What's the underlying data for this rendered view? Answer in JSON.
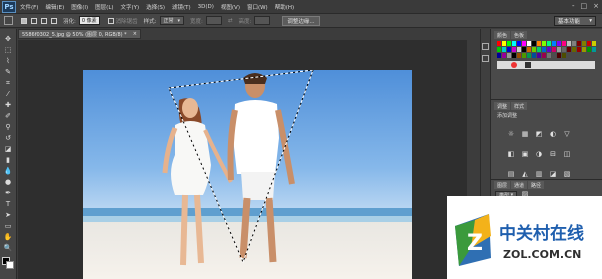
{
  "app": {
    "logo_text": "Ps"
  },
  "menu": [
    "文件(F)",
    "编辑(E)",
    "图像(I)",
    "图层(L)",
    "文字(Y)",
    "选择(S)",
    "滤镜(T)",
    "3D(D)",
    "视图(V)",
    "窗口(W)",
    "帮助(H)"
  ],
  "window_controls": [
    "-",
    "□",
    "×"
  ],
  "options_bar": {
    "feather_label": "羽化:",
    "feather_value": "0 像素",
    "antialias_label": "消除锯齿",
    "style_label": "样式:",
    "style_value": "正常",
    "width_label": "宽度:",
    "height_label": "高度:",
    "refine_edge_button": "调整边缘...",
    "workspace": "基本功能"
  },
  "document": {
    "tab_label": "5586f0302_5.jpg @ 50% (图层 0, RGB/8) *",
    "close": "×"
  },
  "right_panel": {
    "tabs_top": [
      "颜色",
      "色板"
    ],
    "adjust_tabs": [
      "调整",
      "样式"
    ],
    "adjust_title": "添加调整",
    "layers_tabs": [
      "图层",
      "通道",
      "路径"
    ],
    "layers_kind": "类型"
  },
  "watermark": {
    "brand": "中关村在线",
    "url": "ZOL.COM.CN",
    "logo_letter": "Z"
  },
  "colors": {
    "swatches": [
      "#ff0000",
      "#ffff00",
      "#00ff00",
      "#00ffff",
      "#0000ff",
      "#ff00ff",
      "#ffffff",
      "#000000",
      "#ff8000",
      "#80ff00",
      "#00ff80",
      "#0080ff",
      "#8000ff",
      "#ff0080",
      "#c0c0c0",
      "#808080",
      "#800000",
      "#808000"
    ]
  }
}
